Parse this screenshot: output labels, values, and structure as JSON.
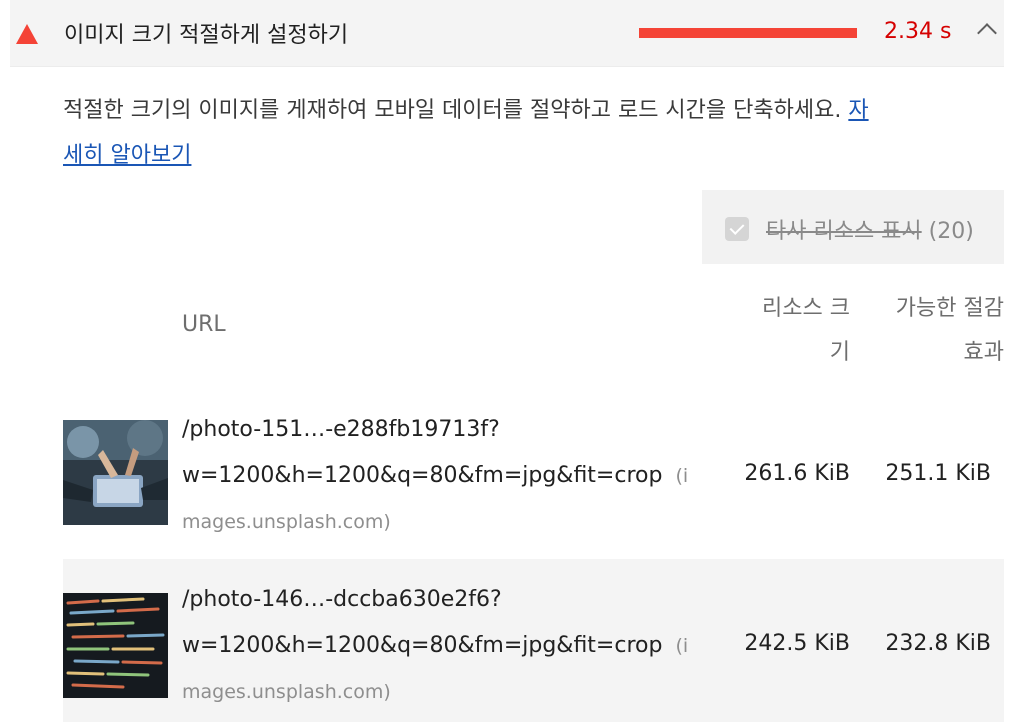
{
  "audit": {
    "title": "이미지 크기 적절하게 설정하기",
    "score": "2.34 s",
    "score_color": "#d50000",
    "bar_color": "#f44336",
    "description": "적절한 크기의 이미지를 게재하여 모바일 데이터를 절약하고 로드 시간을 단축하세요.",
    "learn_more_label": "자세히 알아보기",
    "learn_more_part1": "자",
    "learn_more_part2": "세히 알아보기"
  },
  "filter": {
    "label": "타사 리소스 표시",
    "count": "(20)"
  },
  "table": {
    "headers": {
      "url": "URL",
      "resource_size": "리소스 크기",
      "resource_size_line1": "리소스 크",
      "resource_size_line2": "기",
      "savings": "가능한 절감 효과",
      "savings_line1": "가능한 절감",
      "savings_line2": "효과"
    },
    "rows": [
      {
        "url_line1": "/photo-151…-e288fb19713f?",
        "url_line2": "w=1200&h=1200&q=80&fm=jpg&fit=crop",
        "origin_head": "(i",
        "origin_tail": "mages.unsplash.com)",
        "resource_size": "261.6 KiB",
        "savings": "251.1 KiB"
      },
      {
        "url_line1": "/photo-146…-dccba630e2f6?",
        "url_line2": "w=1200&h=1200&q=80&fm=jpg&fit=crop",
        "origin_head": "(i",
        "origin_tail": "mages.unsplash.com)",
        "resource_size": "242.5 KiB",
        "savings": "232.8 KiB"
      }
    ]
  }
}
